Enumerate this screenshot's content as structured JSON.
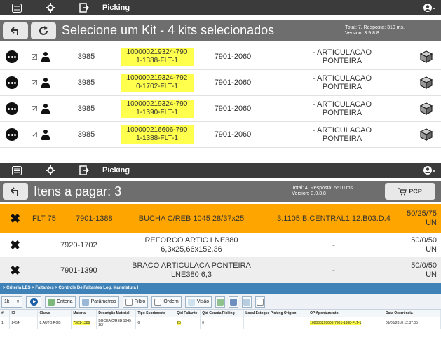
{
  "panel1": {
    "topbar": {
      "title": "Picking"
    },
    "header": {
      "title": "Selecione um Kit - 4 kits selecionados",
      "info_line1": "Total: 7. Resposta: 310 ms.",
      "info_line2": "Version: 3.9.8.8"
    },
    "kits": [
      {
        "num": "3985",
        "op_line1": "100000219324-790",
        "op_line2": "1-1388-FLT-1",
        "code": "7901-2060",
        "desc": "- ARTICULACAO PONTEIRA"
      },
      {
        "num": "3985",
        "op_line1": "100000219324-792",
        "op_line2": "0-1702-FLT-1",
        "code": "7901-2060",
        "desc": "- ARTICULACAO PONTEIRA"
      },
      {
        "num": "3985",
        "op_line1": "100000219324-790",
        "op_line2": "1-1390-FLT-1",
        "code": "7901-2060",
        "desc": "- ARTICULACAO PONTEIRA"
      },
      {
        "num": "3985",
        "op_line1": "100000216606-790",
        "op_line2": "1-1388-FLT-1",
        "code": "7901-2060",
        "desc": "- ARTICULACAO PONTEIRA"
      }
    ]
  },
  "panel2": {
    "topbar": {
      "title": "Picking"
    },
    "header": {
      "title": "Itens a pagar: 3",
      "info_line1": "Total: 4. Resposta: 5510 ms.",
      "info_line2": "Version: 3.9.8.8",
      "pcp_label": "PCP"
    },
    "items": [
      {
        "flt": "FLT 75",
        "code": "7901-1388",
        "desc_line1": "BUCHA C/REB 1045 28/37x25",
        "desc_line2": "",
        "loc": "3.1105.B.CENTRAL1.12.B03.D.4",
        "qty_line1": "50/25/75",
        "qty_line2": "UN"
      },
      {
        "flt": "",
        "code": "7920-1702",
        "desc_line1": "REFORCO ARTIC LNE380",
        "desc_line2": "6,3x25,66x152,36",
        "loc": "-",
        "qty_line1": "50/0/50",
        "qty_line2": "UN"
      },
      {
        "flt": "",
        "code": "7901-1390",
        "desc_line1": "BRACO ARTICULACA PONTEIRA",
        "desc_line2": "LNE380 6,3",
        "loc": "-",
        "qty_line1": "50/0/50",
        "qty_line2": "UN"
      }
    ]
  },
  "panel3": {
    "breadcrumb": "> Criteria LES > Faltantes > Controle De Faltantes Log. Manufatura I",
    "page_size": "1k",
    "tools": [
      "Criteria",
      "Parâmetros",
      "Filtro",
      "Ordem",
      "Visão"
    ],
    "columns": [
      "#",
      "ID",
      "Chave",
      "Material",
      "Descrição Material",
      "Tipo Suprimento",
      "Qtd Faltante",
      "Qtd Gerada Picking",
      "Local Estoque Picking Origem",
      "OP Apontamento",
      "Data Ocorrência"
    ],
    "rows": [
      [
        "1",
        "2454",
        "8.AUTO.ROB",
        "7901-1388",
        "BUCHA C/REB 1045 28/",
        "6",
        "25",
        "0",
        "",
        "100000216606-7901-1388-FLT-1",
        "09/03/2018 12:37:05"
      ]
    ]
  },
  "colors": {
    "topbar": "#3b3b3b",
    "header": "#6e6e6e",
    "highlight_row": "#ffa500",
    "marker": "#ffff4d",
    "grid_header": "#3e82b8"
  }
}
